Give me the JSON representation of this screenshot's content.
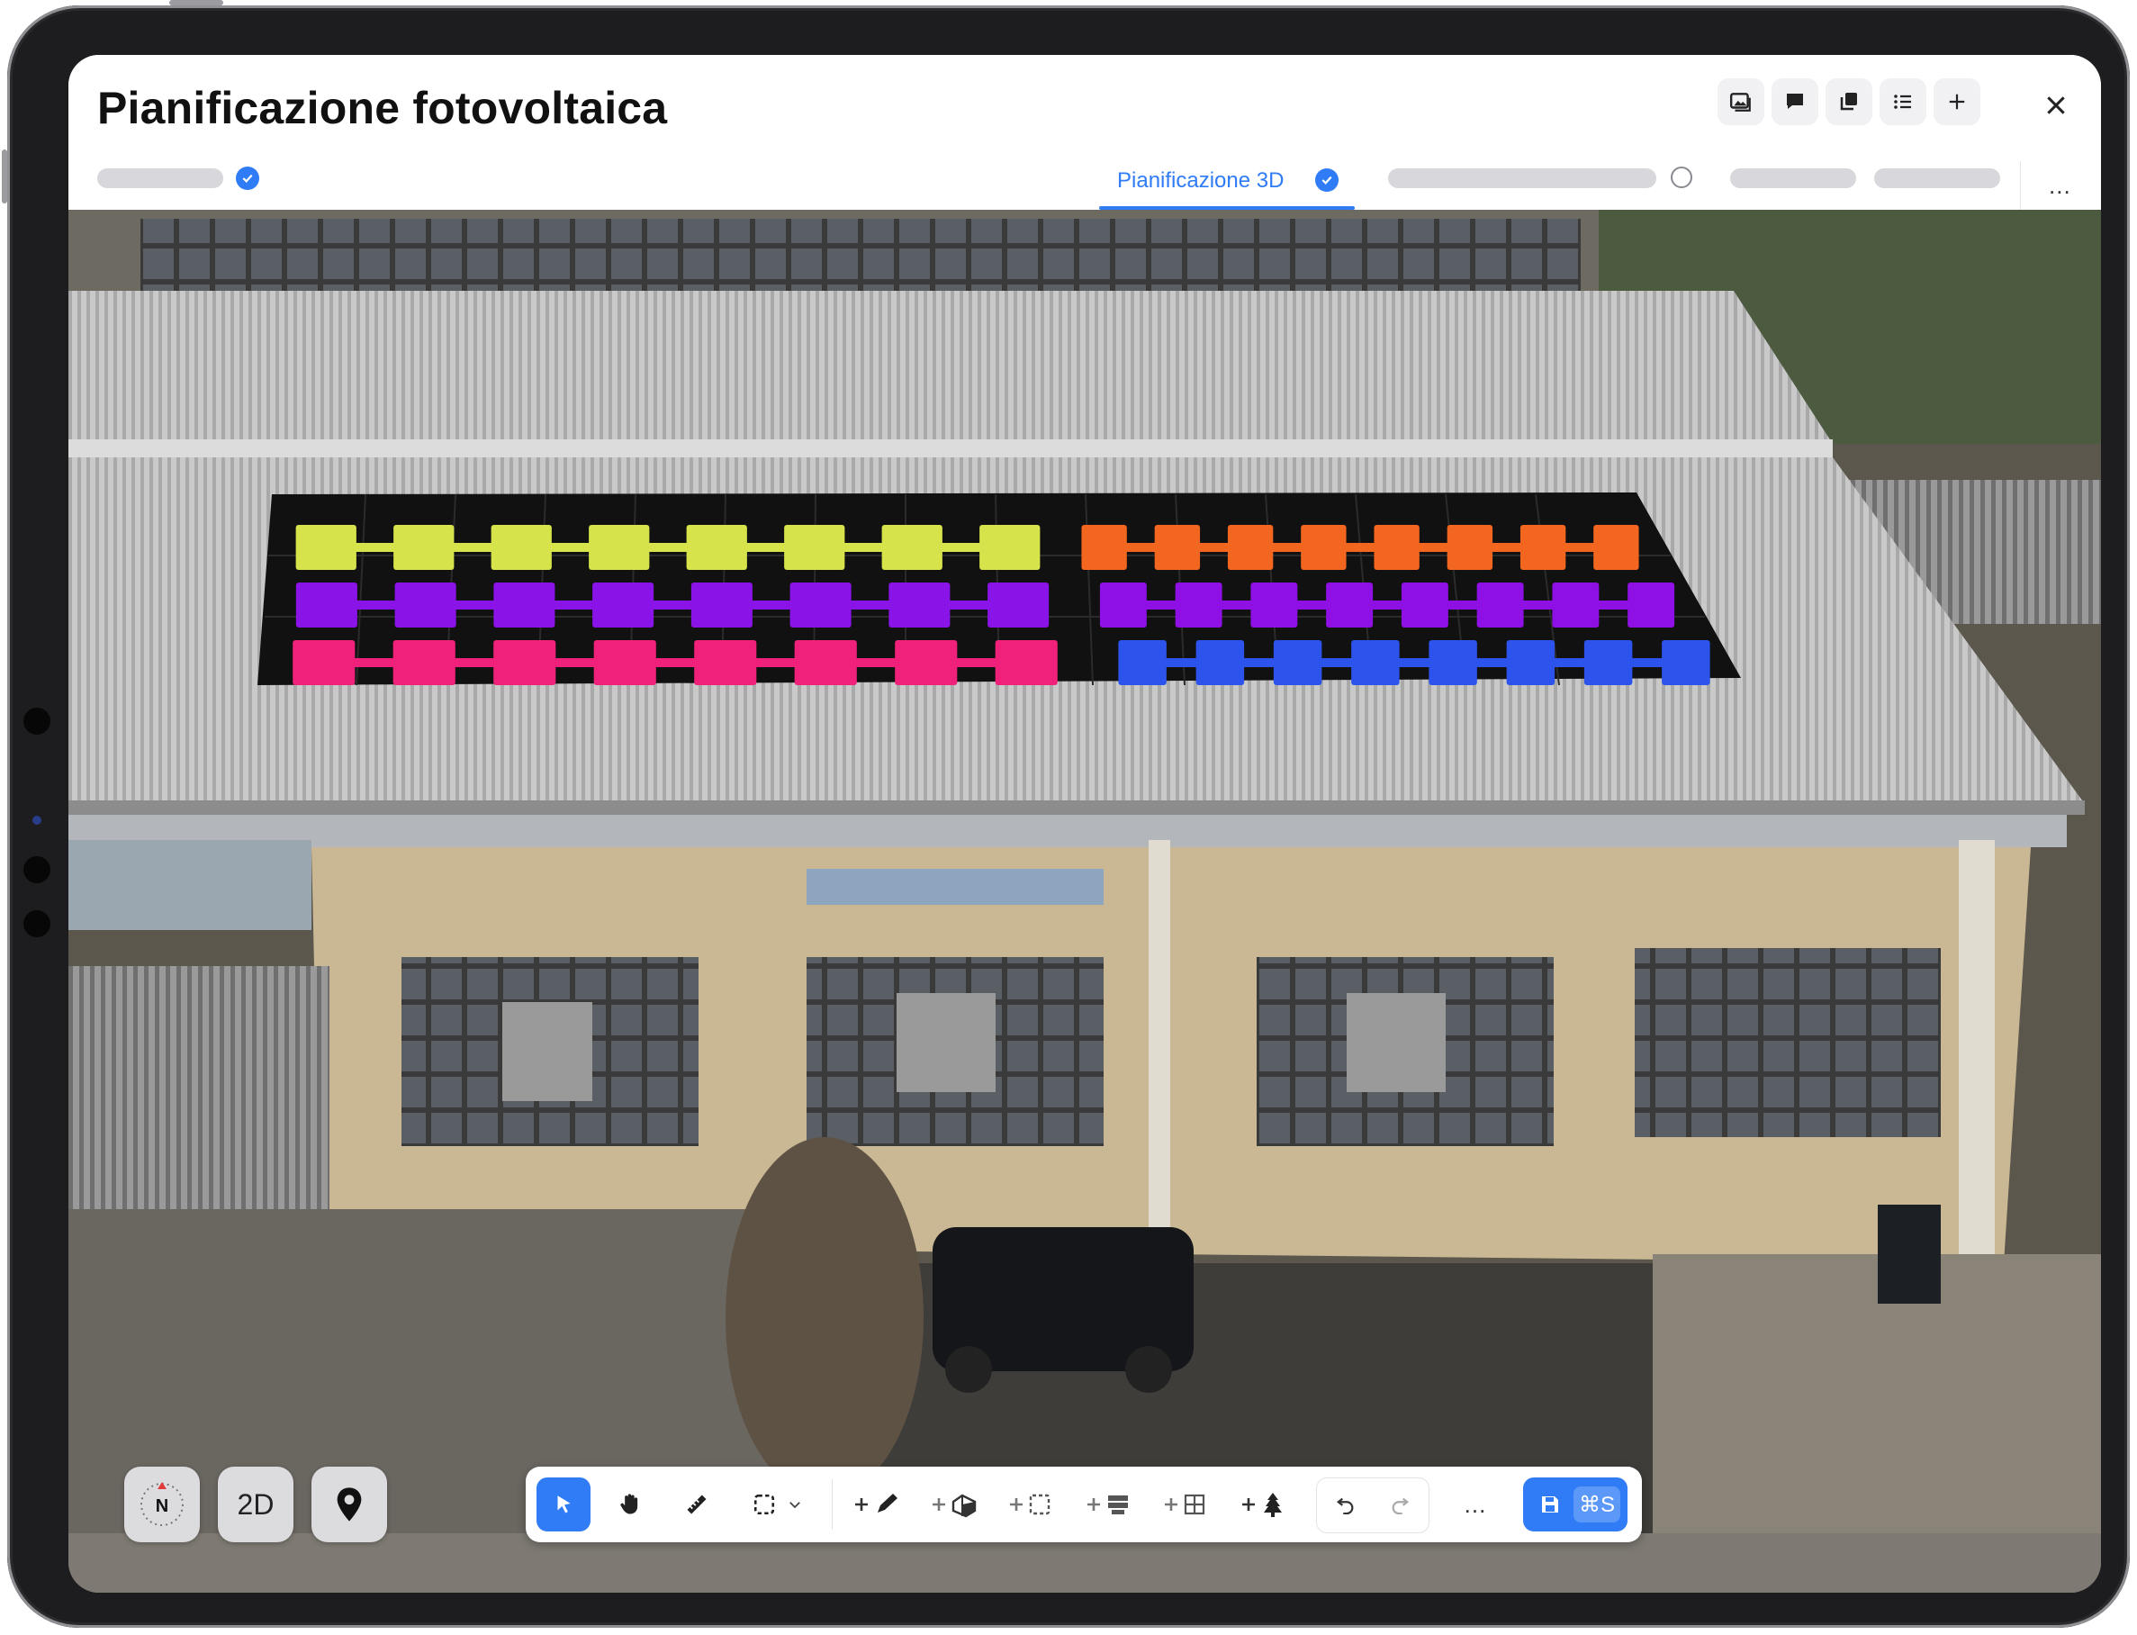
{
  "header": {
    "title": "Pianificazione fotovoltaica",
    "icons": [
      "gallery-icon",
      "comment-icon",
      "layers-icon",
      "list-icon",
      "plus-icon"
    ],
    "close_icon": "close-icon"
  },
  "steps": {
    "active_tab_label": "Pianificazione 3D",
    "more_label": "..."
  },
  "viewport": {
    "controls": {
      "compass_label": "N",
      "view_mode_label": "2D",
      "location_icon": "location-pin-icon"
    }
  },
  "toolbar": {
    "tools": [
      "select-icon",
      "hand-icon",
      "ruler-icon",
      "selection-rect-icon",
      "add-pen-icon",
      "add-obstacle-icon",
      "add-area-icon",
      "add-panel-row-icon",
      "add-grid-icon",
      "add-tree-icon",
      "undo-icon",
      "redo-icon"
    ],
    "more_label": "...",
    "save_shortcut": "⌘S"
  },
  "colors": {
    "accent": "#2f7cf6",
    "string_colors": [
      "#d6e34a",
      "#f2661f",
      "#8a14e8",
      "#8e10e4",
      "#f0217a",
      "#2c54ec"
    ]
  }
}
